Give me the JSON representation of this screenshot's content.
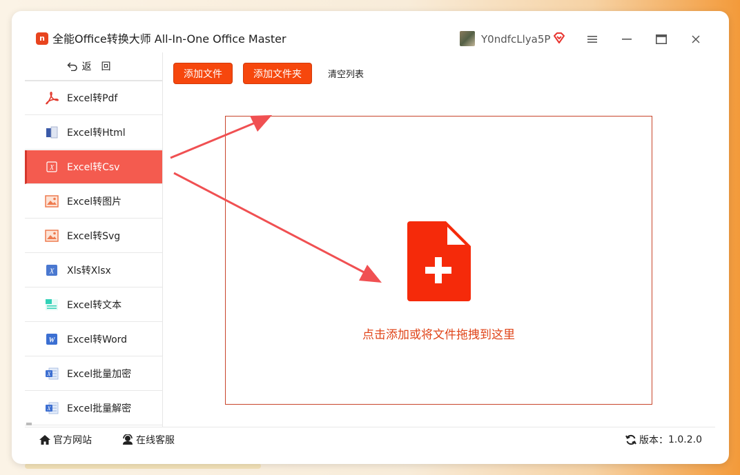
{
  "app": {
    "logo_text": "n",
    "title": "全能Office转换大师 All-In-One Office Master",
    "username": "Y0ndfcLlya5P"
  },
  "sidebar": {
    "back_label": "返回",
    "items": [
      {
        "label": "Excel转Pdf",
        "icon": "pdf-icon",
        "active": false
      },
      {
        "label": "Excel转Html",
        "icon": "html-icon",
        "active": false
      },
      {
        "label": "Excel转Csv",
        "icon": "csv-icon",
        "active": true
      },
      {
        "label": "Excel转图片",
        "icon": "image-icon",
        "active": false
      },
      {
        "label": "Excel转Svg",
        "icon": "svg-icon",
        "active": false
      },
      {
        "label": "Xls转Xlsx",
        "icon": "excel-icon",
        "active": false
      },
      {
        "label": "Excel转文本",
        "icon": "text-icon",
        "active": false
      },
      {
        "label": "Excel转Word",
        "icon": "word-icon",
        "active": false
      },
      {
        "label": "Excel批量加密",
        "icon": "excel-batch-icon",
        "active": false
      },
      {
        "label": "Excel批量解密",
        "icon": "excel-batch-icon",
        "active": false
      }
    ]
  },
  "toolbar": {
    "add_file": "添加文件",
    "add_folder": "添加文件夹",
    "clear_list": "清空列表"
  },
  "dropzone": {
    "hint": "点击添加或将文件拖拽到这里"
  },
  "footer": {
    "website": "官方网站",
    "support": "在线客服",
    "version_label": "版本：",
    "version": "1.0.2.0"
  },
  "colors": {
    "accent": "#f6470d",
    "active_item": "#f45b4f",
    "arrow": "#f05052"
  }
}
